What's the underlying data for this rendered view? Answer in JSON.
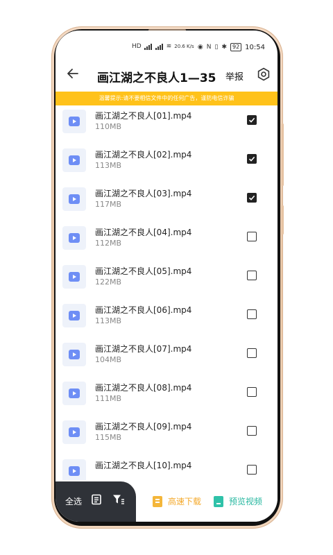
{
  "status_bar": {
    "left_icons": [
      "HD",
      "4G",
      "4G",
      "wifi"
    ],
    "net_speed": "20.6 K/s",
    "right_icons": [
      "eye",
      "nfc",
      "vibrate",
      "bluetooth"
    ],
    "battery": "92",
    "time": "10:54"
  },
  "header": {
    "title": "画江湖之不良人1—35",
    "report_label": "举报"
  },
  "warning": "温馨提示:请不要相信文件中的任何广告，谨防电信诈骗",
  "files": [
    {
      "name": "画江湖之不良人[01].mp4",
      "size": "110MB",
      "checked": true
    },
    {
      "name": "画江湖之不良人[02].mp4",
      "size": "113MB",
      "checked": true
    },
    {
      "name": "画江湖之不良人[03].mp4",
      "size": "117MB",
      "checked": true
    },
    {
      "name": "画江湖之不良人[04].mp4",
      "size": "112MB",
      "checked": false
    },
    {
      "name": "画江湖之不良人[05].mp4",
      "size": "122MB",
      "checked": false
    },
    {
      "name": "画江湖之不良人[06].mp4",
      "size": "113MB",
      "checked": false
    },
    {
      "name": "画江湖之不良人[07].mp4",
      "size": "104MB",
      "checked": false
    },
    {
      "name": "画江湖之不良人[08].mp4",
      "size": "111MB",
      "checked": false
    },
    {
      "name": "画江湖之不良人[09].mp4",
      "size": "115MB",
      "checked": false
    },
    {
      "name": "画江湖之不良人[10].mp4",
      "size": "",
      "checked": false
    }
  ],
  "toolbar": {
    "select_all": "全选",
    "fast_download": "高速下载",
    "preview_video": "预览视频"
  },
  "colors": {
    "warning_bg": "#ffc21a",
    "toolbar_dark": "#2f3238",
    "fast_download": "#f4a92b",
    "preview": "#25b79f",
    "video_icon": "#6e8ef5"
  }
}
